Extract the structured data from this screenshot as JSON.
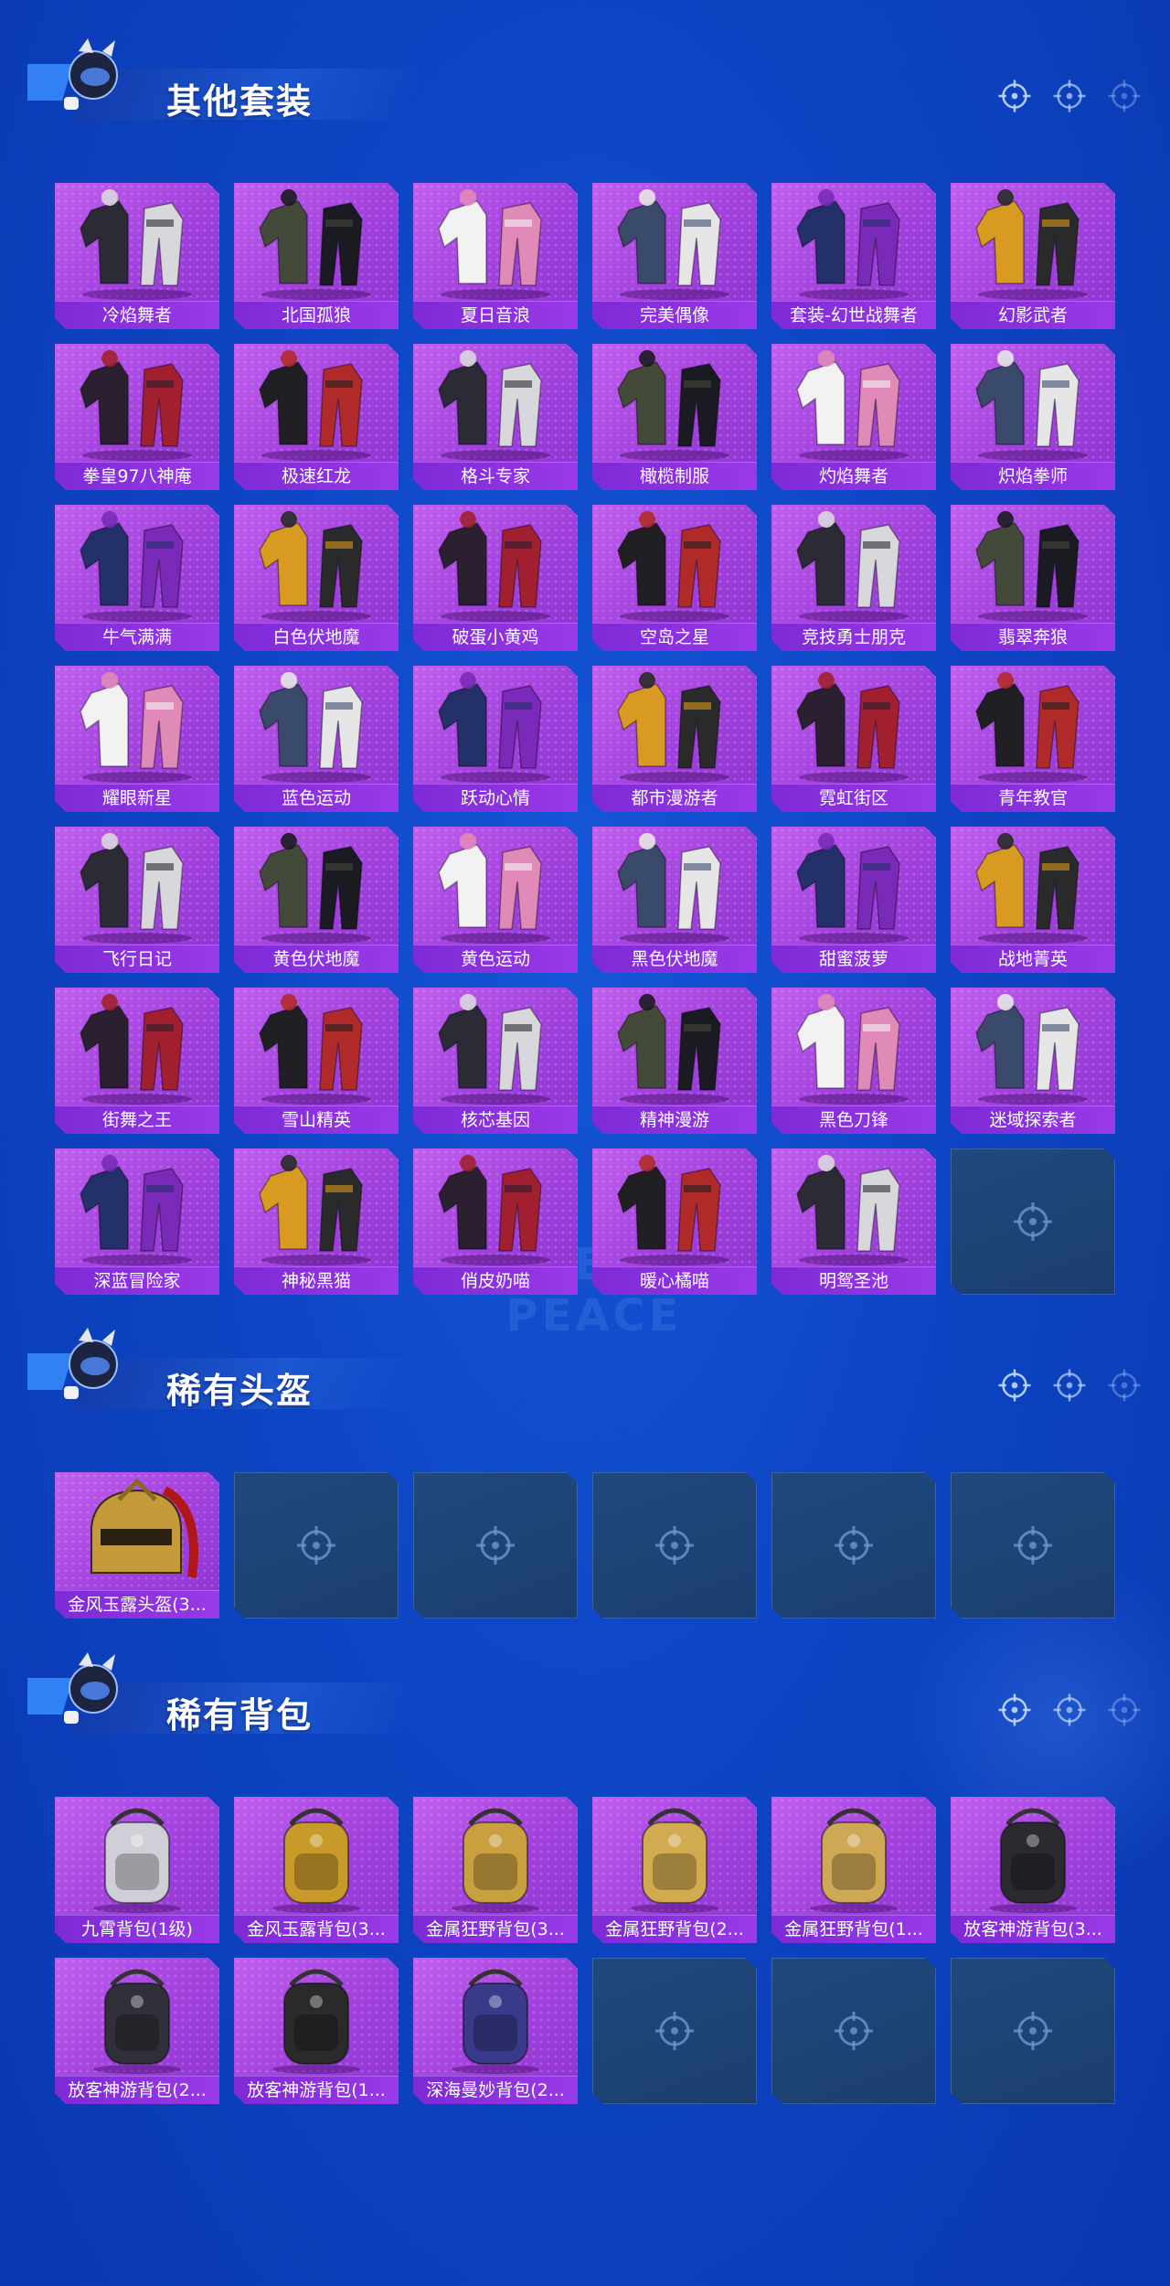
{
  "sections": [
    {
      "title": "其他套装",
      "items": [
        "冷焰舞者",
        "北国孤狼",
        "夏日音浪",
        "完美偶像",
        "套装-幻世战舞者",
        "幻影武者",
        "拳皇97八神庵",
        "极速红龙",
        "格斗专家",
        "橄榄制服",
        "灼焰舞者",
        "炽焰拳师",
        "牛气满满",
        "白色伏地魔",
        "破蛋小黄鸡",
        "空岛之星",
        "竞技勇士朋克",
        "翡翠奔狼",
        "耀眼新星",
        "蓝色运动",
        "跃动心情",
        "都市漫游者",
        "霓虹街区",
        "青年教官",
        "飞行日记",
        "黄色伏地魔",
        "黄色运动",
        "黑色伏地魔",
        "甜蜜菠萝",
        "战地菁英",
        "街舞之王",
        "雪山精英",
        "核芯基因",
        "精神漫游",
        "黑色刀锋",
        "迷域探索者",
        "深蓝冒险家",
        "神秘黑猫",
        "俏皮奶喵",
        "暖心橘喵",
        "明鸳圣池"
      ],
      "empty_slots": 1
    },
    {
      "title": "稀有头盔",
      "items": [
        "金风玉露头盔(3..."
      ],
      "empty_slots": 5
    },
    {
      "title": "稀有背包",
      "items": [
        "九霄背包(1级)",
        "金风玉露背包(3...",
        "金属狂野背包(3...",
        "金属狂野背包(2...",
        "金属狂野背包(1...",
        "放客神游背包(3...",
        "放客神游背包(2...",
        "放客神游背包(1...",
        "深海曼妙背包(2..."
      ],
      "empty_slots": 3
    }
  ],
  "watermark": "GAME FOR PEACE",
  "colors": {
    "card_purple": "#a645e0",
    "label_purple": "#8d32d0",
    "empty_slot": "#1f4579",
    "background": "#0d45c4"
  },
  "icons": {
    "empty_slot": "crosshair-icon",
    "header_decor": "crosshair-icon",
    "mascot": "mascot-icon"
  }
}
